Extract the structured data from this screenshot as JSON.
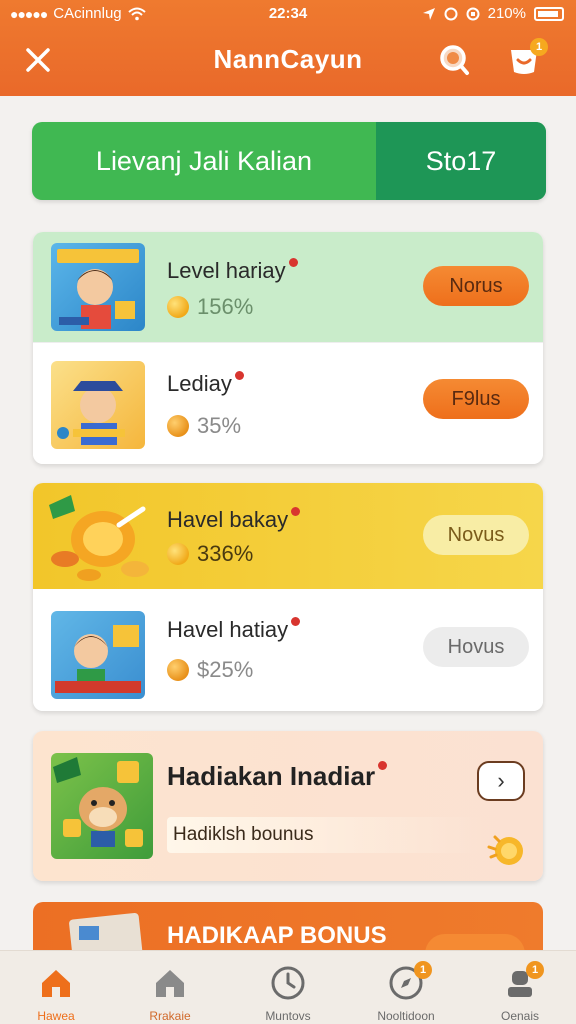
{
  "status_bar": {
    "carrier": "CAcinnlug",
    "time": "22:34",
    "battery": "210%"
  },
  "header": {
    "title": "NannCayun",
    "cart_badge": "1",
    "icons": [
      "close-icon",
      "search-icon",
      "cart-icon"
    ]
  },
  "hero": {
    "left_text": "Lievanj Jali Kalian",
    "right_text": "Sto17"
  },
  "cards": [
    {
      "rows": [
        {
          "title": "Level hariay",
          "percent": "156%",
          "button": "Norus",
          "button_style": "orange"
        },
        {
          "title": "Lediay",
          "percent": "35%",
          "button": "F9lus",
          "button_style": "orange"
        }
      ]
    },
    {
      "rows": [
        {
          "title": "Havel bakay",
          "percent": "336%",
          "button": "Novus",
          "button_style": "yellow"
        },
        {
          "title": "Havel hatiay",
          "percent": "$25%",
          "button": "Hovus",
          "button_style": "grey"
        }
      ]
    }
  ],
  "bonus": {
    "title": "Hadiakan Inadiar",
    "subtitle": "Hadiklsh bounus"
  },
  "banner": {
    "text": "HADIKAAP BONUS"
  },
  "tabs": [
    {
      "label": "Hawea",
      "icon": "home-icon",
      "active": true
    },
    {
      "label": "Rrakaie",
      "icon": "store-icon",
      "active": false
    },
    {
      "label": "Muntovs",
      "icon": "clock-icon",
      "active": false
    },
    {
      "label": "Nooltidoon",
      "icon": "compass-icon",
      "active": false,
      "badge": "1"
    },
    {
      "label": "Oenais",
      "icon": "profile-icon",
      "active": false,
      "badge": "1"
    }
  ],
  "colors": {
    "header_orange": "#e9692a",
    "hero_green": "#40b852",
    "hero_dark_green": "#1e9656",
    "accent_orange": "#ee6f1b",
    "card1_top_bg": "#c7ecc8",
    "card2_top_bg": "#f3cc2c"
  }
}
